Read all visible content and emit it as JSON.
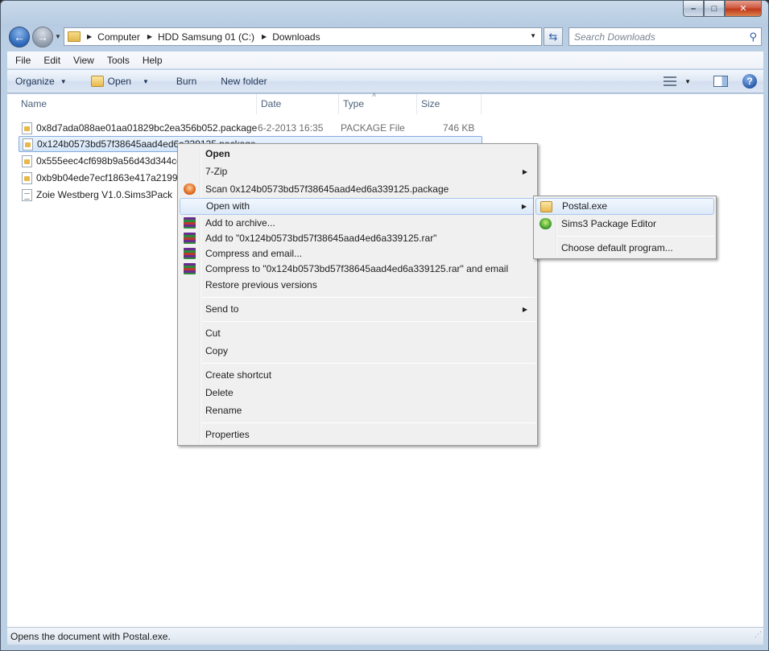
{
  "window": {
    "caption": {
      "minimize": "–",
      "maximize": "□",
      "close": "✕"
    }
  },
  "address": {
    "crumbs": [
      "Computer",
      "HDD Samsung 01 (C:)",
      "Downloads"
    ],
    "search_placeholder": "Search Downloads"
  },
  "menubar": [
    "File",
    "Edit",
    "View",
    "Tools",
    "Help"
  ],
  "toolbar": {
    "organize": "Organize",
    "open": "Open",
    "burn": "Burn",
    "new_folder": "New folder"
  },
  "columns": [
    "Name",
    "Date",
    "Type",
    "Size"
  ],
  "files": [
    {
      "name": "0x8d7ada088ae01aa01829bc2ea356b052.package",
      "date": "6-2-2013 16:35",
      "type": "PACKAGE File",
      "size": "746 KB",
      "selected": false
    },
    {
      "name": "0x124b0573bd57f38645aad4ed6a339125.package",
      "date": "",
      "type": "",
      "size": "",
      "selected": true
    },
    {
      "name": "0x555eec4cf698b9a56d43d344ce2",
      "date": "",
      "type": "",
      "size": "",
      "selected": false
    },
    {
      "name": "0xb9b04ede7ecf1863e417a219922",
      "date": "",
      "type": "",
      "size": "",
      "selected": false
    },
    {
      "name": "Zoie Westberg V1.0.Sims3Pack",
      "date": "",
      "type": "",
      "size": "",
      "selected": false
    }
  ],
  "context_menu": {
    "open": "Open",
    "zip": "7-Zip",
    "scan": "Scan 0x124b0573bd57f38645aad4ed6a339125.package",
    "open_with": "Open with",
    "add_archive": "Add to archive...",
    "add_rar": "Add to \"0x124b0573bd57f38645aad4ed6a339125.rar\"",
    "compress_email": "Compress and email...",
    "compress_rar_email": "Compress to \"0x124b0573bd57f38645aad4ed6a339125.rar\" and email",
    "restore": "Restore previous versions",
    "send_to": "Send to",
    "cut": "Cut",
    "copy": "Copy",
    "create_shortcut": "Create shortcut",
    "delete": "Delete",
    "rename": "Rename",
    "properties": "Properties"
  },
  "submenu": {
    "postal": "Postal.exe",
    "sims3": "Sims3 Package Editor",
    "choose_default": "Choose default program..."
  },
  "status": "Opens the document with Postal.exe."
}
